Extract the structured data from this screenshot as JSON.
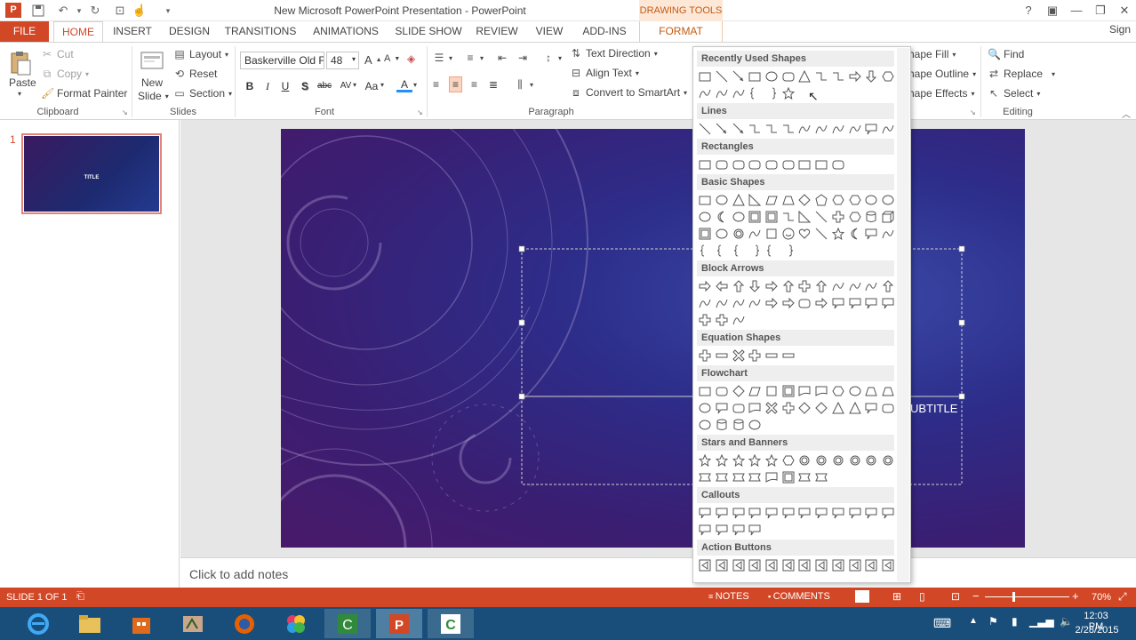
{
  "window": {
    "title": "New Microsoft PowerPoint Presentation - PowerPoint",
    "context_group": "DRAWING TOOLS",
    "sign_in": "Sign"
  },
  "tabs": [
    "FILE",
    "HOME",
    "INSERT",
    "DESIGN",
    "TRANSITIONS",
    "ANIMATIONS",
    "SLIDE SHOW",
    "REVIEW",
    "VIEW",
    "ADD-INS",
    "FORMAT"
  ],
  "clipboard": {
    "paste": "Paste",
    "cut": "Cut",
    "copy": "Copy",
    "format_painter": "Format Painter",
    "label": "Clipboard"
  },
  "slides": {
    "new_slide_line1": "New",
    "new_slide_line2": "Slide",
    "layout": "Layout",
    "reset": "Reset",
    "section": "Section",
    "label": "Slides"
  },
  "font": {
    "name": "Baskerville Old F",
    "size": "48",
    "label": "Font",
    "bold": "B",
    "italic": "I",
    "underline": "U",
    "shadow": "S",
    "strike": "abc",
    "spacing": "AV",
    "case": "Aa",
    "color": "A"
  },
  "paragraph": {
    "text_direction": "Text Direction",
    "align_text": "Align Text",
    "convert_smartart": "Convert to SmartArt",
    "label": "Paragraph"
  },
  "drawing": {
    "shape_fill": "hape Fill",
    "shape_outline": "hape Outline",
    "shape_effects": "hape Effects"
  },
  "editing": {
    "find": "Find",
    "replace": "Replace",
    "select": "Select",
    "label": "Editing"
  },
  "thumbnails": [
    {
      "number": "1",
      "title": "TITLE"
    }
  ],
  "slide": {
    "subtitle_fragment": "UBTITLE"
  },
  "notes": {
    "placeholder": "Click to add notes"
  },
  "status": {
    "slide_info": "SLIDE 1 OF 1",
    "notes": "NOTES",
    "comments": "COMMENTS",
    "zoom": "70%"
  },
  "taskbar": {
    "time": "12:03 PM",
    "date": "2/28/2015"
  },
  "gallery": {
    "categories": [
      "Recently Used Shapes",
      "Lines",
      "Rectangles",
      "Basic Shapes",
      "Block Arrows",
      "Equation Shapes",
      "Flowchart",
      "Stars and Banners",
      "Callouts",
      "Action Buttons"
    ]
  },
  "colors": {
    "accent": "#d24726",
    "format_tab": "#c55a11",
    "taskbar": "#1a4e7a"
  }
}
